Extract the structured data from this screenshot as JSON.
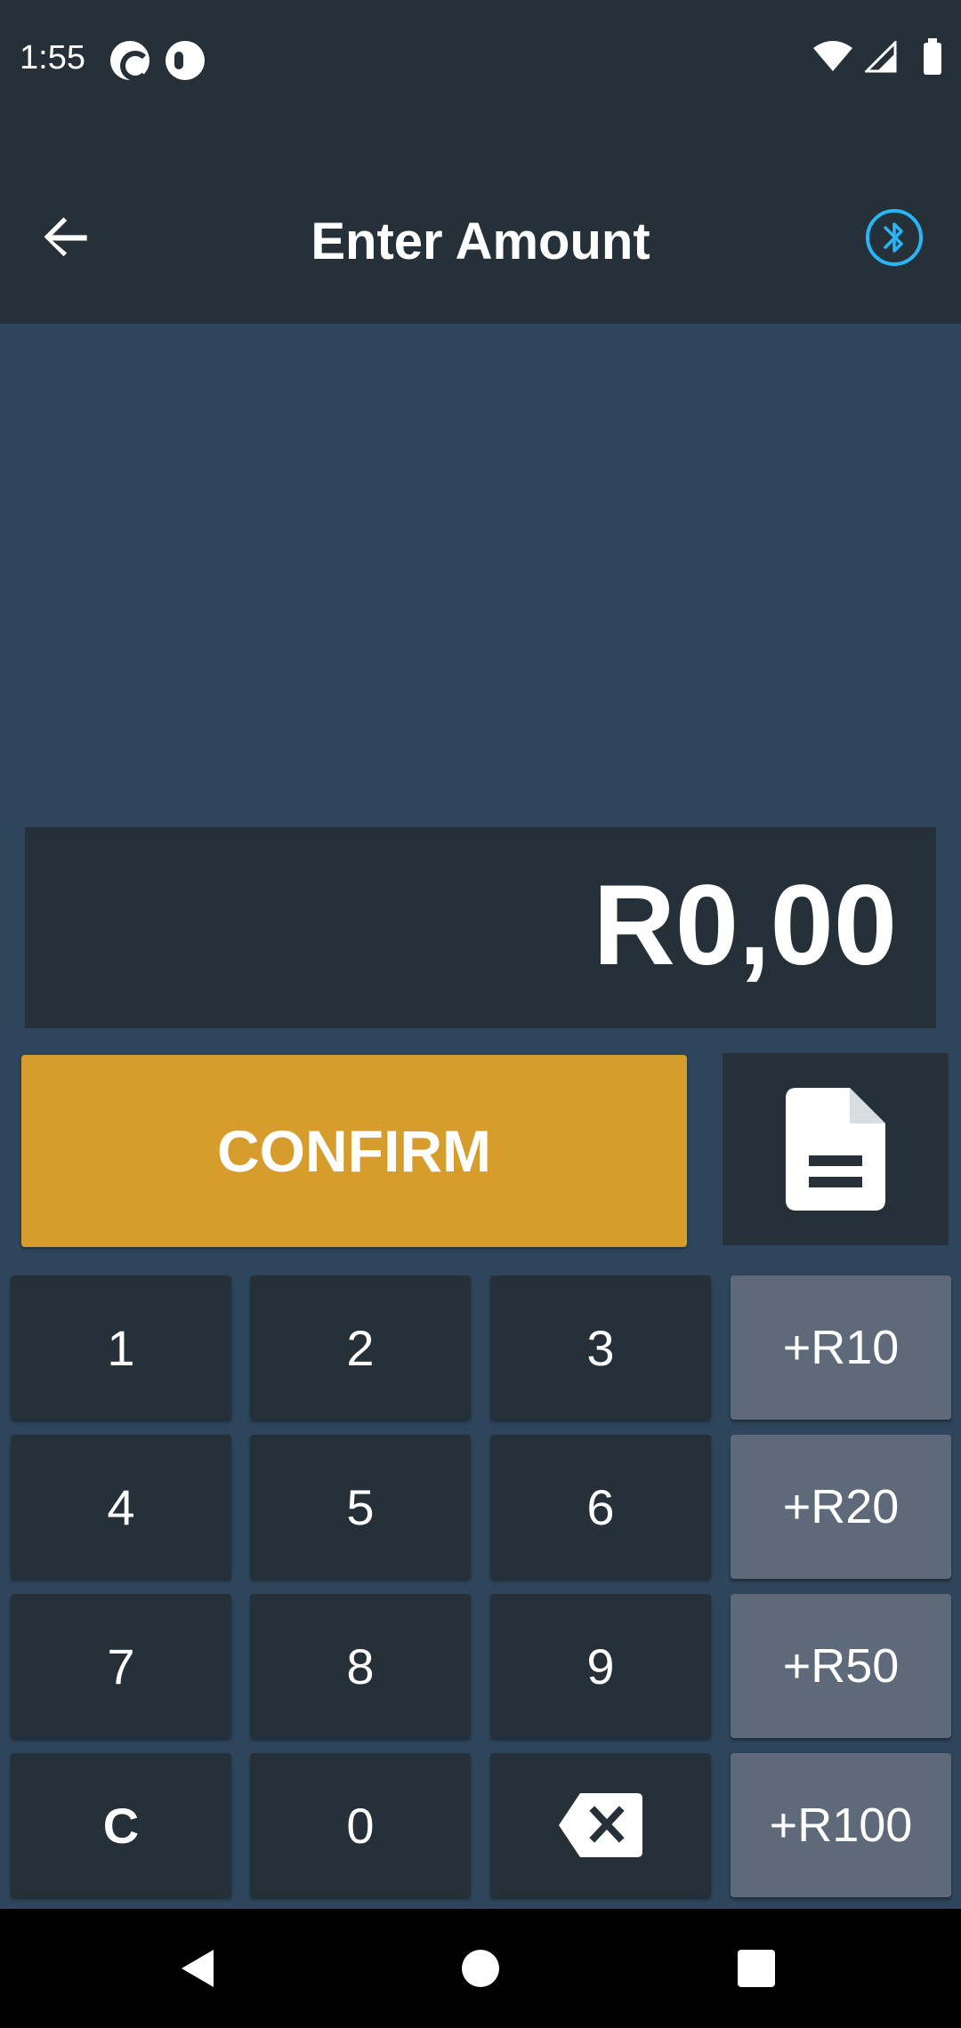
{
  "status_bar": {
    "time": "1:55"
  },
  "toolbar": {
    "title": "Enter Amount",
    "bluetooth_color": "#29b6f6"
  },
  "amount": {
    "value": "R0,00"
  },
  "actions": {
    "confirm_label": "CONFIRM",
    "confirm_color": "#d69c2c"
  },
  "keypad": {
    "digits": [
      "1",
      "2",
      "3",
      "4",
      "5",
      "6",
      "7",
      "8",
      "9",
      "C",
      "0"
    ],
    "quick_amounts": [
      "+R10",
      "+R20",
      "+R50",
      "+R100"
    ],
    "backspace_icon": "backspace-icon"
  },
  "colors": {
    "bar_background": "#263038",
    "page_background": "#2e455b",
    "quick_key_background": "#5e6a79"
  }
}
